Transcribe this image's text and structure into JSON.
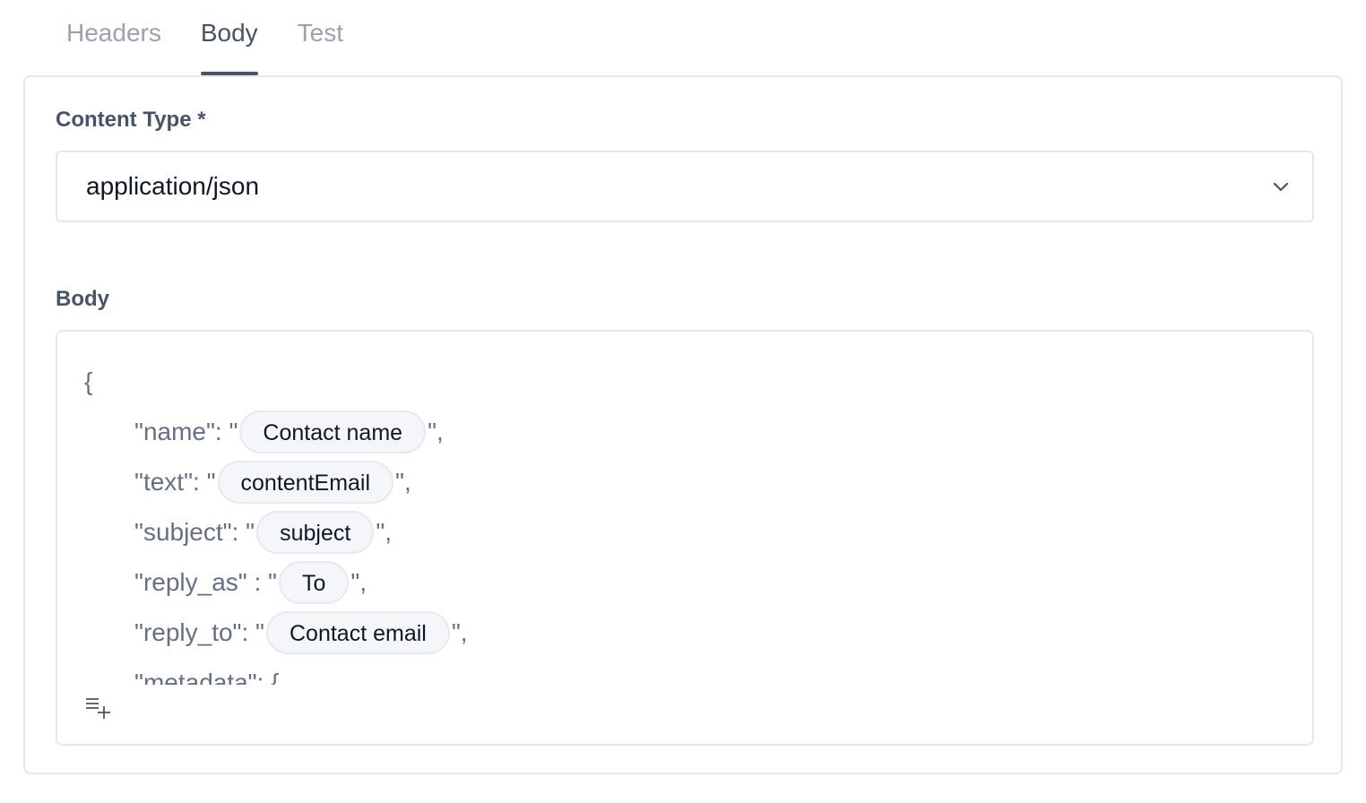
{
  "tabs": [
    {
      "label": "Headers",
      "active": false
    },
    {
      "label": "Body",
      "active": true
    },
    {
      "label": "Test",
      "active": false
    }
  ],
  "content_type": {
    "label": "Content Type *",
    "value": "application/json"
  },
  "body": {
    "label": "Body",
    "open_brace": "{",
    "lines": [
      {
        "prefix": "\"name\": \"",
        "chip": "Contact name",
        "suffix": "\","
      },
      {
        "prefix": "\"text\": \"",
        "chip": "contentEmail",
        "suffix": "\","
      },
      {
        "prefix": "\"subject\": \"",
        "chip": "subject",
        "suffix": "\","
      },
      {
        "prefix": "\"reply_as\" : \"",
        "chip": "To",
        "suffix": "\","
      },
      {
        "prefix": "\"reply_to\": \"",
        "chip": "Contact email",
        "suffix": "\","
      }
    ],
    "partial_line": "\"metadata\": {"
  },
  "icons": {
    "select_chevron": "chevron-down-icon",
    "insert_variable": "list-add-icon"
  },
  "colors": {
    "active_tab": "#475467",
    "inactive_tab": "#98a2b3",
    "chip_bg": "#f5f6fa",
    "border": "#e4e7ec"
  }
}
